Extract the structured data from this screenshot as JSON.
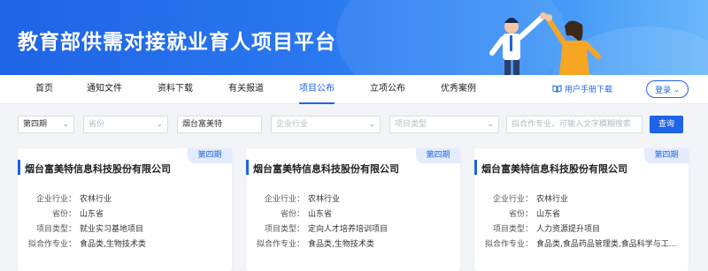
{
  "banner": {
    "title": "教育部供需对接就业育人项目平台"
  },
  "nav": {
    "items": [
      {
        "label": "首页"
      },
      {
        "label": "通知文件"
      },
      {
        "label": "资料下载"
      },
      {
        "label": "有关报道"
      },
      {
        "label": "项目公布"
      },
      {
        "label": "立项公布"
      },
      {
        "label": "优秀案例"
      }
    ],
    "active": "项目公布",
    "manual_label": "用户手册下载",
    "login_label": "登录"
  },
  "filters": {
    "period": "第四期",
    "province_placeholder": "省份",
    "company_value": "烟台富美特",
    "industry_placeholder": "企业行业",
    "type_placeholder": "项目类型",
    "major_placeholder": "拟合作专业，可输入文字模糊搜索",
    "search_label": "查询"
  },
  "field_labels": {
    "industry": "企业行业：",
    "province": "省份：",
    "type": "项目类型：",
    "major": "拟合作专业："
  },
  "cards": [
    {
      "company": "烟台富美特信息科技股份有限公司",
      "badge": "第四期",
      "industry": "农林行业",
      "province": "山东省",
      "type": "就业实习基地项目",
      "major": "食品类,生物技术类"
    },
    {
      "company": "烟台富美特信息科技股份有限公司",
      "badge": "第四期",
      "industry": "农林行业",
      "province": "山东省",
      "type": "定向人才培养培训项目",
      "major": "食品类,生物技术类"
    },
    {
      "company": "烟台富美特信息科技股份有限公司",
      "badge": "第四期",
      "industry": "农林行业",
      "province": "山东省",
      "type": "人力资源提升项目",
      "major": "食品类,食品药品管理类,食品科学与工..."
    }
  ],
  "colors": {
    "primary": "#1f63e6",
    "badge_bg": "#e2ecfd",
    "page_bg": "#f2f4f8"
  }
}
